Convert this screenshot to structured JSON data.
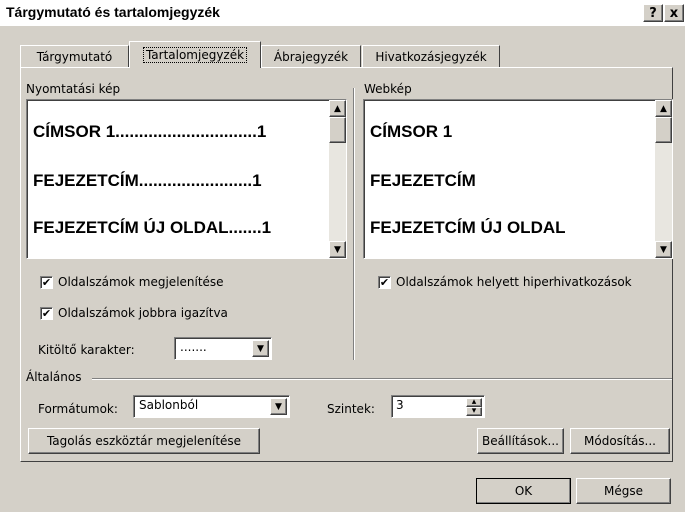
{
  "window": {
    "title": "Tárgymutató és tartalomjegyzék",
    "help_label": "?",
    "close_label": "x"
  },
  "tabs": [
    {
      "label": "Tárgymutató",
      "active": false
    },
    {
      "label": "Tartalomjegyzék",
      "active": true
    },
    {
      "label": "Ábrajegyzék",
      "active": false
    },
    {
      "label": "Hivatkozásjegyzék",
      "active": false
    }
  ],
  "print_preview": {
    "label": "Nyomtatási kép",
    "lines": [
      "CÍMSOR 1..............................1",
      "FEJEZETCÍM........................1",
      "FEJEZETCÍM ÚJ OLDAL.......1"
    ]
  },
  "web_preview": {
    "label": "Webkép",
    "lines": [
      "CÍMSOR 1",
      "FEJEZETCÍM",
      "FEJEZETCÍM ÚJ OLDAL"
    ]
  },
  "options": {
    "show_page_numbers": {
      "label": "Oldalszámok megjelenítése",
      "checked": true
    },
    "right_align_page_numbers": {
      "label": "Oldalszámok jobbra igazítva",
      "checked": true
    },
    "hyperlinks_instead": {
      "label": "Oldalszámok helyett hiperhivatkozások",
      "checked": true
    },
    "tab_leader_label": "Kitöltő karakter:",
    "tab_leader_value": "......."
  },
  "general": {
    "label": "Általános",
    "formats_label": "Formátumok:",
    "formats_value": "Sablonból",
    "levels_label": "Szintek:",
    "levels_value": "3"
  },
  "buttons": {
    "outline_toolbar": "Tagolás eszköztár megjelenítése",
    "settings": "Beállítások...",
    "modify": "Módosítás...",
    "ok": "OK",
    "cancel": "Mégse"
  },
  "check_glyph": "✔",
  "icons": {
    "up_arrow": "▲",
    "down_arrow": "▼",
    "spin_up": "▴",
    "spin_down": "▾"
  }
}
